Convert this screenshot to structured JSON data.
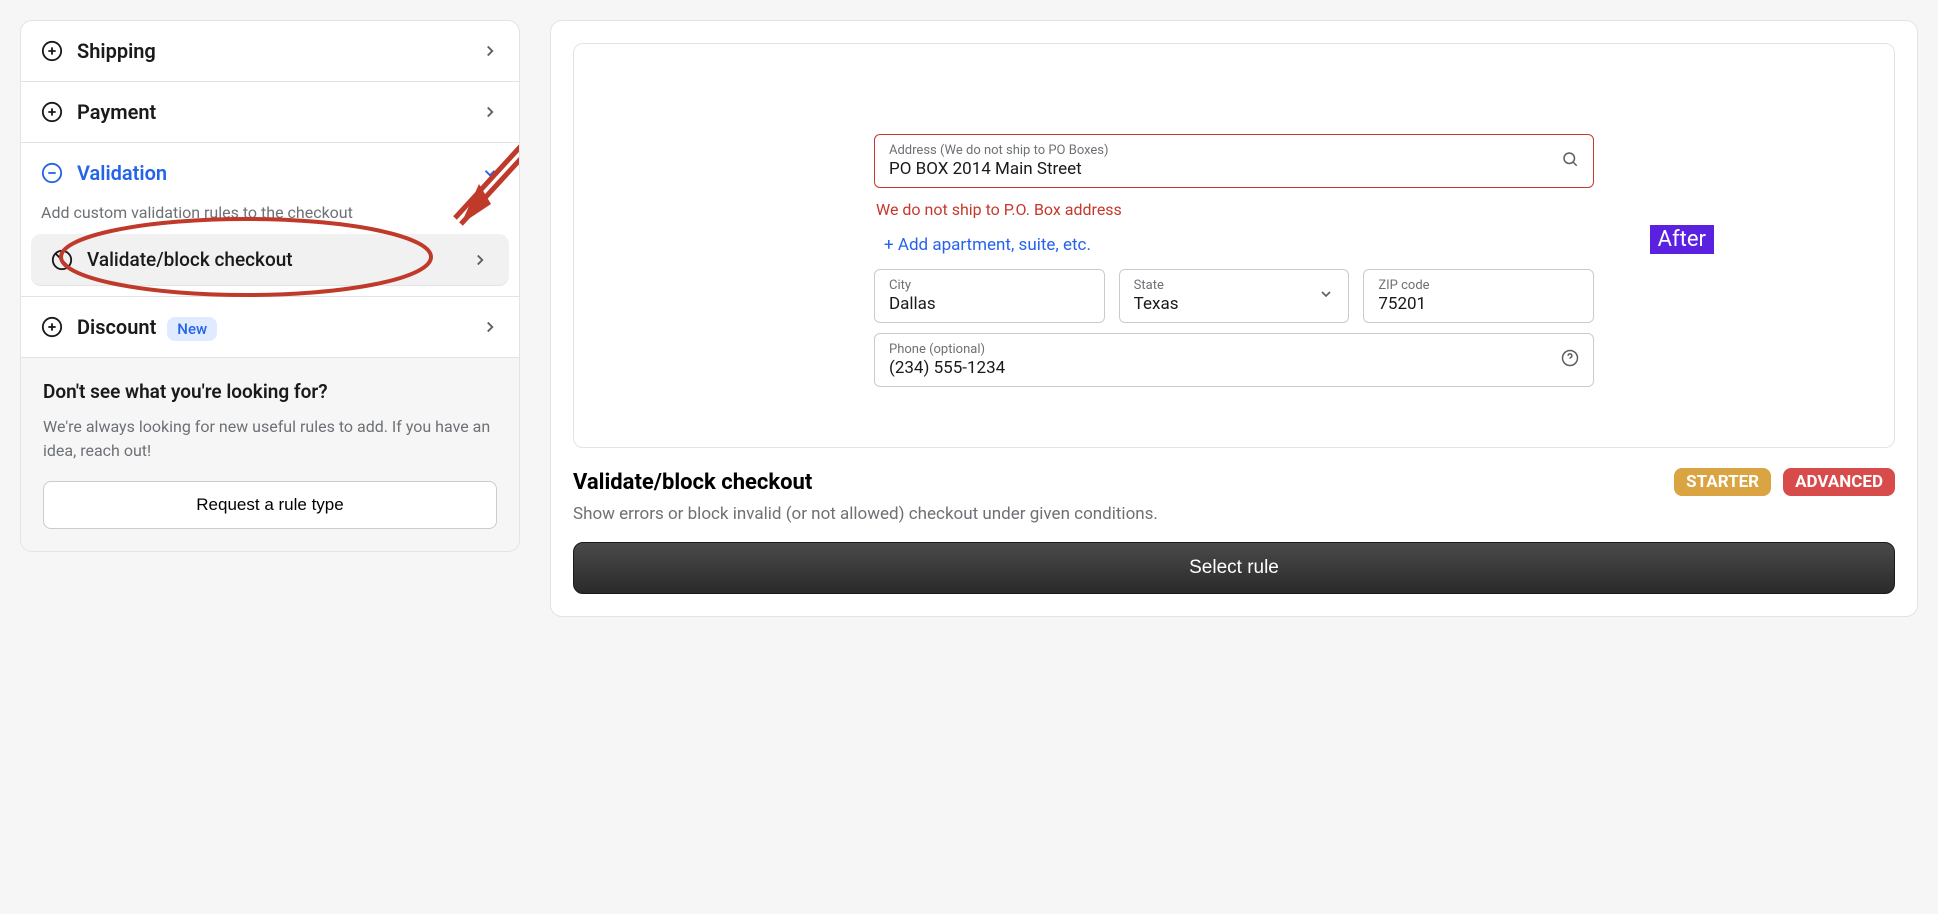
{
  "sidebar": {
    "items": [
      {
        "label": "Shipping",
        "icon": "plus-circle"
      },
      {
        "label": "Payment",
        "icon": "plus-circle"
      },
      {
        "label": "Validation",
        "icon": "minus-circle",
        "active": true
      },
      {
        "label": "Discount",
        "icon": "plus-circle",
        "badge": "New"
      }
    ],
    "validation_desc": "Add custom validation rules to the checkout",
    "sub_item": {
      "label": "Validate/block checkout",
      "icon": "ban"
    },
    "footer": {
      "title": "Don't see what you're looking for?",
      "desc": "We're always looking for new useful rules to add. If you have an idea, reach out!",
      "button": "Request a rule type"
    }
  },
  "preview": {
    "address": {
      "label": "Address (We do not ship to PO Boxes)",
      "value": "PO BOX 2014 Main Street",
      "error": "We do not ship to P.O. Box address"
    },
    "add_apt": "+ Add apartment, suite, etc.",
    "after_badge": "After",
    "city": {
      "label": "City",
      "value": "Dallas"
    },
    "state": {
      "label": "State",
      "value": "Texas"
    },
    "zip": {
      "label": "ZIP code",
      "value": "75201"
    },
    "phone": {
      "label": "Phone (optional)",
      "value": "(234) 555-1234"
    }
  },
  "details": {
    "title": "Validate/block checkout",
    "desc": "Show errors or block invalid (or not allowed) checkout under given conditions.",
    "tiers": [
      "STARTER",
      "ADVANCED"
    ],
    "select_button": "Select rule"
  }
}
